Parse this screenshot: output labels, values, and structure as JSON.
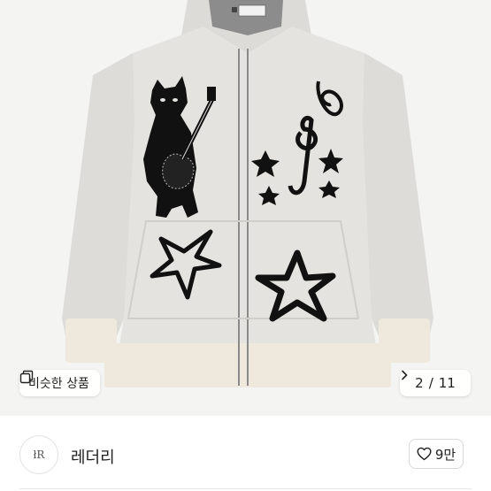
{
  "gallery": {
    "image_alt": "knit hoodie zip-up with cat playing guitar, stars and music note",
    "similar_button": {
      "label": "비슷한 상품",
      "icon": "copy-icon"
    },
    "pager": {
      "current": "2",
      "separator": "/",
      "total": "11",
      "icon": "chevron-right-icon"
    }
  },
  "seller": {
    "name": "레더리",
    "avatar_mark": "łR",
    "like": {
      "count": "9만",
      "icon": "heart-outline-icon"
    }
  },
  "colors": {
    "background": "#f4f4f2",
    "knit": "#e4e3df",
    "ink": "#111111",
    "trim": "#efe9dd"
  }
}
